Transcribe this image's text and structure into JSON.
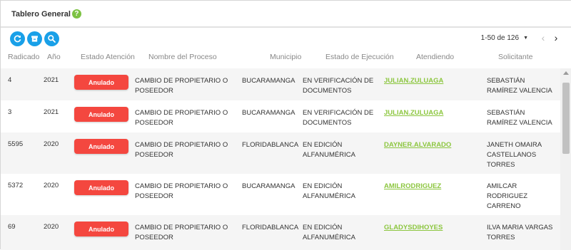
{
  "header": {
    "title": "Tablero General",
    "help_icon": "help-circle-icon"
  },
  "toolbar": {
    "buttons": [
      "refresh-icon",
      "archive-icon",
      "search-icon"
    ]
  },
  "pager": {
    "range": "1-50 de 126",
    "prev": "‹",
    "next": "›"
  },
  "columns": [
    "Radicado",
    "Año",
    "Estado Atención",
    "Nombre del Proceso",
    "Municipio",
    "Estado de Ejecución",
    "Atendiendo",
    "Solicitante"
  ],
  "rows": [
    {
      "radicado": "4",
      "anio": "2021",
      "estado": "Anulado",
      "proceso": [
        "Cambio de propietario o",
        "poseedor"
      ],
      "municipio": "Bucaramanga",
      "ejecucion": [
        "En verificación de",
        "documentos"
      ],
      "atendiendo": "JULIAN.ZULUAGA",
      "solicitante": [
        "Sebastián",
        "Ramírez Valencia"
      ]
    },
    {
      "radicado": "3",
      "anio": "2021",
      "estado": "Anulado",
      "proceso": [
        "Cambio de propietario o",
        "poseedor"
      ],
      "municipio": "Bucaramanga",
      "ejecucion": [
        "En verificación de",
        "documentos"
      ],
      "atendiendo": "JULIAN.ZULUAGA",
      "solicitante": [
        "Sebastián",
        "Ramírez Valencia"
      ]
    },
    {
      "radicado": "5595",
      "anio": "2020",
      "estado": "Anulado",
      "proceso": [
        "Cambio de propietario o",
        "poseedor"
      ],
      "municipio": "Floridablanca",
      "ejecucion": [
        "En edición",
        "alfanumérica"
      ],
      "atendiendo": "DAYNER.ALVARADO",
      "solicitante": [
        "Janeth Omaira",
        "Castellanos",
        "Torres"
      ]
    },
    {
      "radicado": "5372",
      "anio": "2020",
      "estado": "Anulado",
      "proceso": [
        "Cambio de propietario o",
        "poseedor"
      ],
      "municipio": "Bucaramanga",
      "ejecucion": [
        "En edición",
        "alfanumérica"
      ],
      "atendiendo": "AMILRODRIGUEZ",
      "solicitante": [
        "Amilcar",
        "Rodriguez",
        "Carreno"
      ]
    },
    {
      "radicado": "69",
      "anio": "2020",
      "estado": "Anulado",
      "proceso": [
        "Cambio de propietario o",
        "poseedor"
      ],
      "municipio": "Floridablanca",
      "ejecucion": [
        "En edición",
        "alfanumérica"
      ],
      "atendiendo": "GLADYSDIHOYES",
      "solicitante": [
        "Ilva Maria Vargas",
        "Torres"
      ]
    }
  ],
  "colors": {
    "accent": "#19a0e8",
    "danger": "#f4473f",
    "link": "#8cc63f"
  }
}
